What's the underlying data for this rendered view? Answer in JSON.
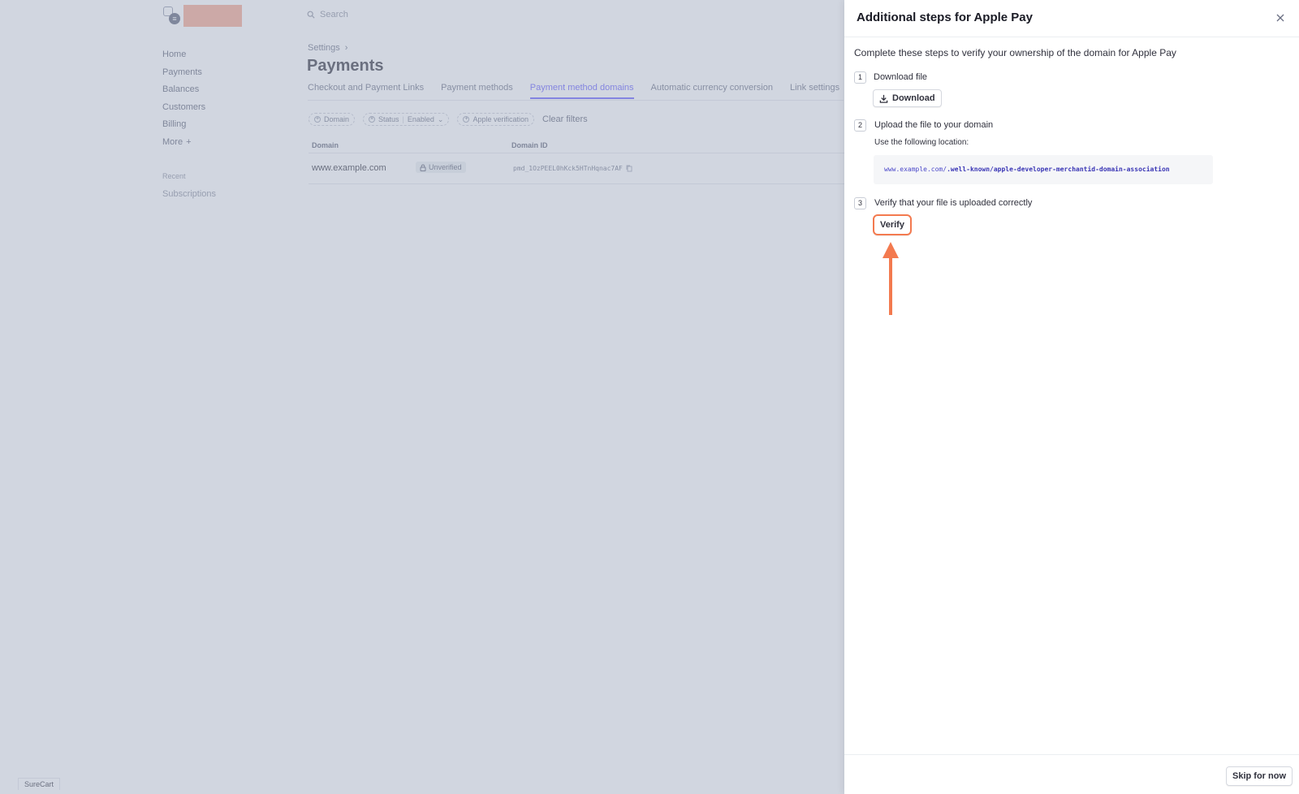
{
  "app": {
    "search_placeholder": "Search",
    "brand": "SureCart"
  },
  "sidebar": {
    "items": [
      {
        "label": "Home"
      },
      {
        "label": "Payments"
      },
      {
        "label": "Balances"
      },
      {
        "label": "Customers"
      },
      {
        "label": "Billing"
      },
      {
        "label": "More",
        "suffix": "+"
      }
    ],
    "recent_title": "Recent",
    "recent_items": [
      {
        "label": "Subscriptions"
      }
    ]
  },
  "main": {
    "breadcrumb": "Settings",
    "breadcrumb_chevron": "›",
    "title": "Payments",
    "tabs": [
      {
        "label": "Checkout and Payment Links"
      },
      {
        "label": "Payment methods"
      },
      {
        "label": "Payment method domains",
        "active": true
      },
      {
        "label": "Automatic currency conversion"
      },
      {
        "label": "Link settings"
      }
    ],
    "filters": {
      "domain": "Domain",
      "status": "Status",
      "status_value": "Enabled",
      "apple_verification": "Apple verification",
      "clear": "Clear filters"
    },
    "table": {
      "headers": {
        "domain": "Domain",
        "domain_id": "Domain ID"
      },
      "rows": [
        {
          "domain": "www.example.com",
          "status": "Unverified",
          "domain_id": "pmd_1OzPEEL0hKck5HTnHqnac7AF"
        }
      ]
    }
  },
  "drawer": {
    "title": "Additional steps for Apple Pay",
    "intro": "Complete these steps to verify your ownership of the domain for Apple Pay",
    "steps": [
      {
        "number": "1",
        "label": "Download file",
        "button": "Download"
      },
      {
        "number": "2",
        "label": "Upload the file to your domain",
        "sublabel": "Use the following location:",
        "path_host": "www.example.com/",
        "path_rest": ".well-known/apple-developer-merchantid-domain-association"
      },
      {
        "number": "3",
        "label": "Verify that your file is uploaded correctly",
        "button": "Verify"
      }
    ],
    "footer_button": "Skip for now"
  },
  "colors": {
    "accent": "#635bff",
    "highlight": "#f37a4f",
    "redaction": "#f4a58d",
    "overlay": "#a3adc2"
  },
  "icons": [
    "search-icon",
    "close-icon",
    "download-icon",
    "lock-icon",
    "copy-icon",
    "chevron-right-icon",
    "chevron-down-icon",
    "plus-circle-icon",
    "x-circle-icon",
    "arrow-up-icon"
  ]
}
